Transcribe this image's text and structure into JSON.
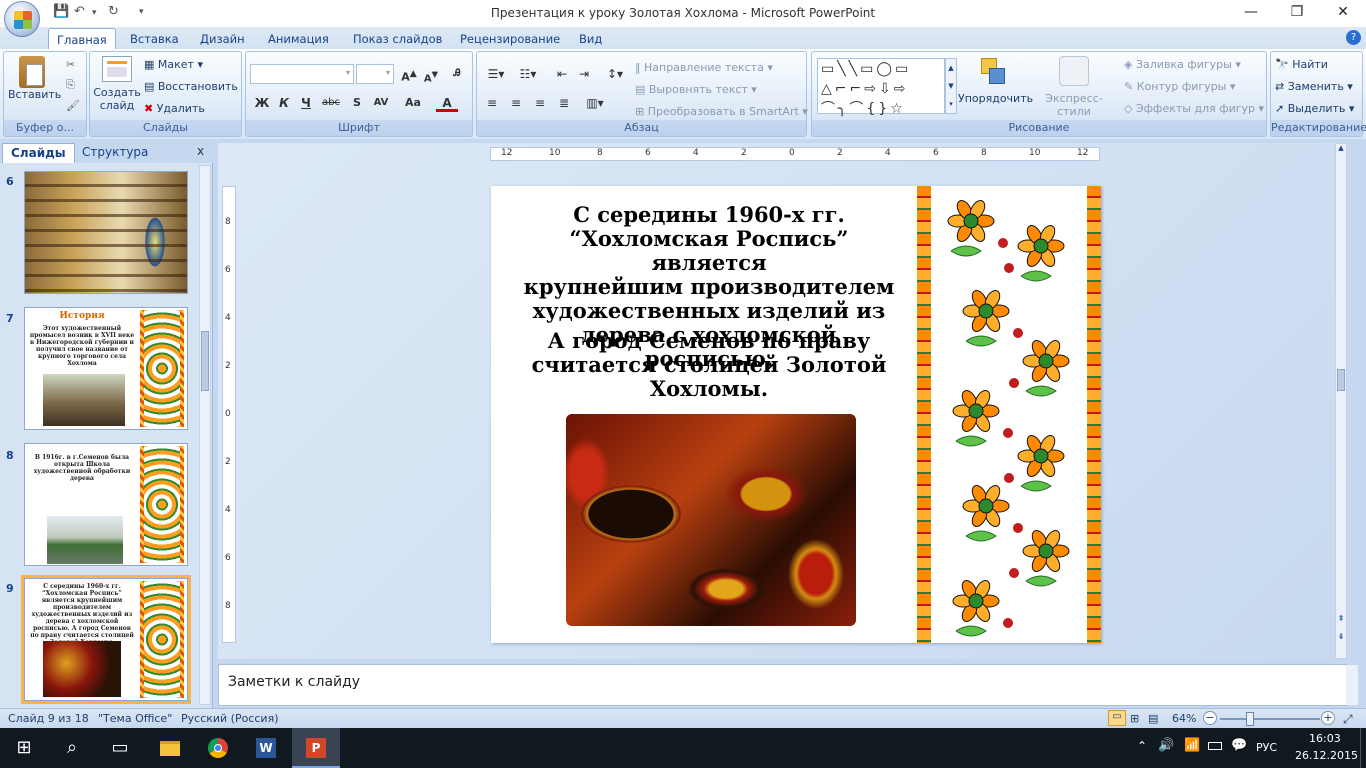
{
  "window": {
    "title": "Презентация к уроку Золотая Хохлома - Microsoft PowerPoint",
    "minimize_glyph": "—",
    "restore_glyph": "❐",
    "close_glyph": "✕"
  },
  "ribbon_tabs": [
    "Главная",
    "Вставка",
    "Дизайн",
    "Анимация",
    "Показ слайдов",
    "Рецензирование",
    "Вид"
  ],
  "ribbon": {
    "clipboard": {
      "paste": "Вставить",
      "caption": "Буфер о..."
    },
    "slides": {
      "new_slide_1": "Создать",
      "new_slide_2": "слайд",
      "layout": "Макет",
      "reset": "Восстановить",
      "delete": "Удалить",
      "caption": "Слайды"
    },
    "font": {
      "caption": "Шрифт",
      "bold": "Ж",
      "italic": "К",
      "underline": "Ч",
      "strike": "abc",
      "spacing": "AV",
      "case": "Аа",
      "color": "A"
    },
    "paragraph": {
      "text_direction": "Направление текста",
      "align_text": "Выровнять текст",
      "smartart": "Преобразовать в SmartArt",
      "caption": "Абзац"
    },
    "drawing": {
      "arrange": "Упорядочить",
      "quick_styles": "Экспресс-стили",
      "fill": "Заливка фигуры",
      "outline": "Контур фигуры",
      "effects": "Эффекты для фигур",
      "caption": "Рисование"
    },
    "editing": {
      "find": "Найти",
      "replace": "Заменить",
      "select": "Выделить",
      "caption": "Редактирование"
    }
  },
  "panel_tabs": {
    "slides": "Слайды",
    "outline": "Структура",
    "close": "x"
  },
  "thumbnails": [
    {
      "num": "6",
      "text": ""
    },
    {
      "num": "7",
      "title": "История",
      "text": "Этот художественный промысел возник в XVII веке в Нижегородской губернии и получил свое название от крупного торгового села Хохлома"
    },
    {
      "num": "8",
      "text": "В 1916г. в г.Семенов была открыта Школа художественной обработки дерева"
    },
    {
      "num": "9",
      "text": "С середины 1960-х гг. “Хохломская Роспись” является крупнейшим производителем художественных изделий из дерева с хохломской росписью. А город Семенов по праву считается столицей Золотой Хохломы."
    }
  ],
  "ruler": {
    "h_labels": [
      "12",
      "10",
      "8",
      "6",
      "4",
      "2",
      "0",
      "2",
      "4",
      "6",
      "8",
      "10",
      "12"
    ],
    "v_labels": [
      "8",
      "6",
      "4",
      "2",
      "0",
      "2",
      "4",
      "6",
      "8"
    ]
  },
  "slide": {
    "para1": [
      "С середины 1960-х гг.",
      "“Хохломская Роспись” является",
      "крупнейшим производителем",
      "художественных изделий из",
      "дерева с хохломской росписью."
    ],
    "para2": [
      "А город Семенов по праву",
      "считается столицей Золотой",
      "Хохломы."
    ]
  },
  "notes_placeholder": "Заметки к слайду",
  "status": {
    "slide_of": "Слайд 9 из 18",
    "theme": "\"Тема Office\"",
    "language": "Русский (Россия)",
    "zoom": "64%",
    "zoom_value": 0.64
  },
  "taskbar": {
    "language": "РУС",
    "time": "16:03",
    "date": "26.12.2015"
  },
  "colors": {
    "accent": "#f8b44a",
    "ribbon_text": "#15428b",
    "khokhloma_red": "#c01e1e",
    "khokhloma_gold": "#ffae2b"
  }
}
